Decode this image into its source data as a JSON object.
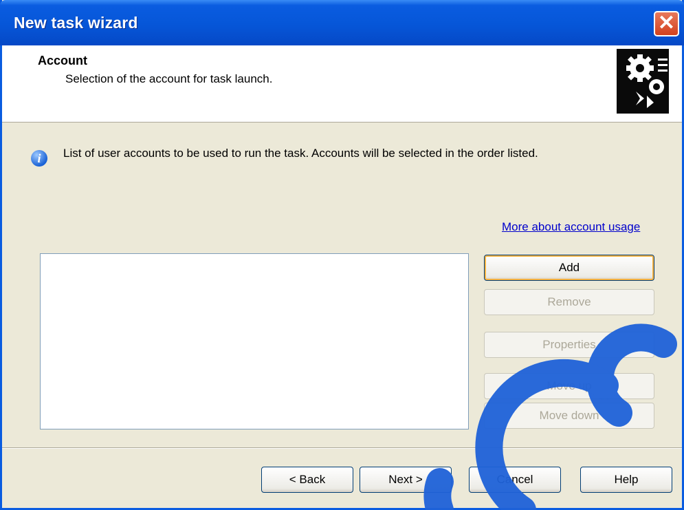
{
  "window": {
    "title": "New task wizard"
  },
  "header": {
    "title": "Account",
    "subtitle": "Selection of the account for task launch.",
    "icon": "gears-icon"
  },
  "info": {
    "icon": "info-icon",
    "text": "List of user accounts to be used to run the task. Accounts will be selected in the order listed."
  },
  "link": {
    "label": "More about account usage"
  },
  "accounts": {
    "items": []
  },
  "side_buttons": {
    "add": "Add",
    "remove": "Remove",
    "properties": "Properties",
    "move_up": "Move up",
    "move_down": "Move down"
  },
  "footer": {
    "back": "< Back",
    "next": "Next >",
    "cancel": "Cancel",
    "help": "Help"
  },
  "colors": {
    "title_bar": "#0a5ce0",
    "dialog_bg": "#ece9d8",
    "link": "#0000cc"
  }
}
